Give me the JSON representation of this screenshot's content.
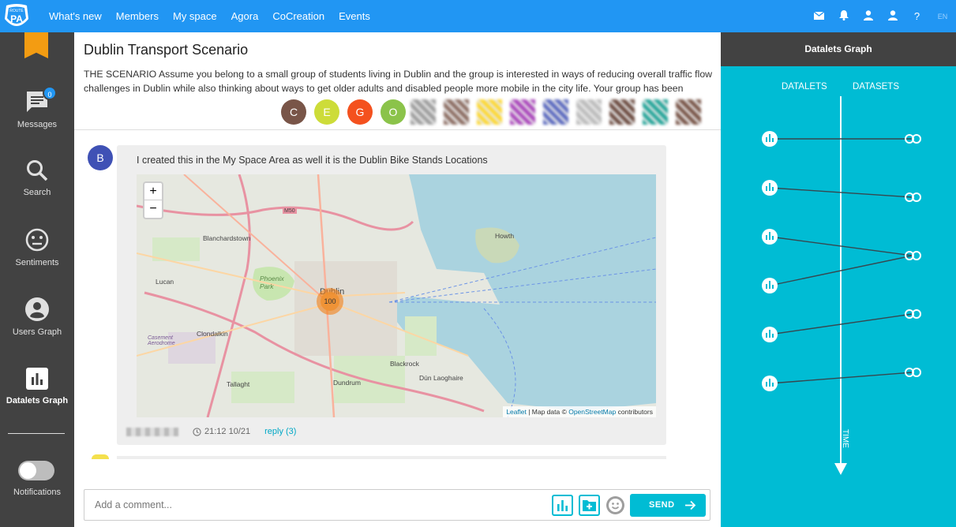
{
  "nav": {
    "logo_text": "ROUTE PA",
    "items": [
      "What's new",
      "Members",
      "My space",
      "Agora",
      "CoCreation",
      "Events"
    ],
    "icons": [
      "mail-icon",
      "bell-icon",
      "user-icon",
      "profile-icon",
      "help-icon"
    ],
    "help_glyph": "?",
    "lang": "EN"
  },
  "sidebar": {
    "messages": {
      "label": "Messages",
      "badge": "0"
    },
    "search": {
      "label": "Search"
    },
    "sentiments": {
      "label": "Sentiments"
    },
    "users_graph": {
      "label": "Users Graph"
    },
    "datalets_graph": {
      "label": "Datalets Graph"
    },
    "notifications": {
      "label": "Notifications"
    }
  },
  "room": {
    "title": "Dublin Transport Scenario",
    "description": "THE SCENARIO Assume you belong to a small group of students living in Dublin and the group is interested in ways of reducing overall traffic flow challenges in Dublin while also thinking about ways to get older adults and disabled people more mobile in the city life. Your group has been",
    "members": [
      {
        "initial": "C",
        "color": "#795548"
      },
      {
        "initial": "E",
        "color": "#cddc39"
      },
      {
        "initial": "G",
        "color": "#f4511e"
      },
      {
        "initial": "O",
        "color": "#8bc34a"
      }
    ],
    "pixel_avatar_colors": [
      "#9e9e9e",
      "#8d6e63",
      "#fdd835",
      "#ab47bc",
      "#5c6bc0",
      "#bdbdbd",
      "#6d4c41",
      "#26a69a",
      "#795548"
    ]
  },
  "message": {
    "author_initial": "B",
    "text": "I created this in the My Space Area as well it is the Dublin Bike Stands Locations",
    "time": "21:12 10/21",
    "reply": "reply (3)",
    "map": {
      "cluster_count": "100",
      "zoom_in": "+",
      "zoom_out": "−",
      "attribution_leaflet": "Leaflet",
      "attribution_rest": " | Map data © ",
      "attribution_osm": "OpenStreetMap",
      "attribution_tail": " contributors",
      "places": {
        "blanchardstown": "Blanchardstown",
        "howth": "Howth",
        "lucan": "Lucan",
        "phoenix": "Phoenix Park",
        "dublin": "Dublin",
        "clondalkin": "Clondalkin",
        "casement": "Casement Aerodrome",
        "tallaght": "Tallaght",
        "dundrum": "Dundrum",
        "blackrock": "Blackrock",
        "dun_laoghaire": "Dún Laoghaire",
        "m50": "M50"
      }
    }
  },
  "composer": {
    "placeholder": "Add a comment...",
    "send_label": "SEND"
  },
  "right_panel": {
    "title": "Datalets Graph",
    "col_datalets": "DATALETS",
    "col_datasets": "DATASETS",
    "time_label": "TIME"
  }
}
